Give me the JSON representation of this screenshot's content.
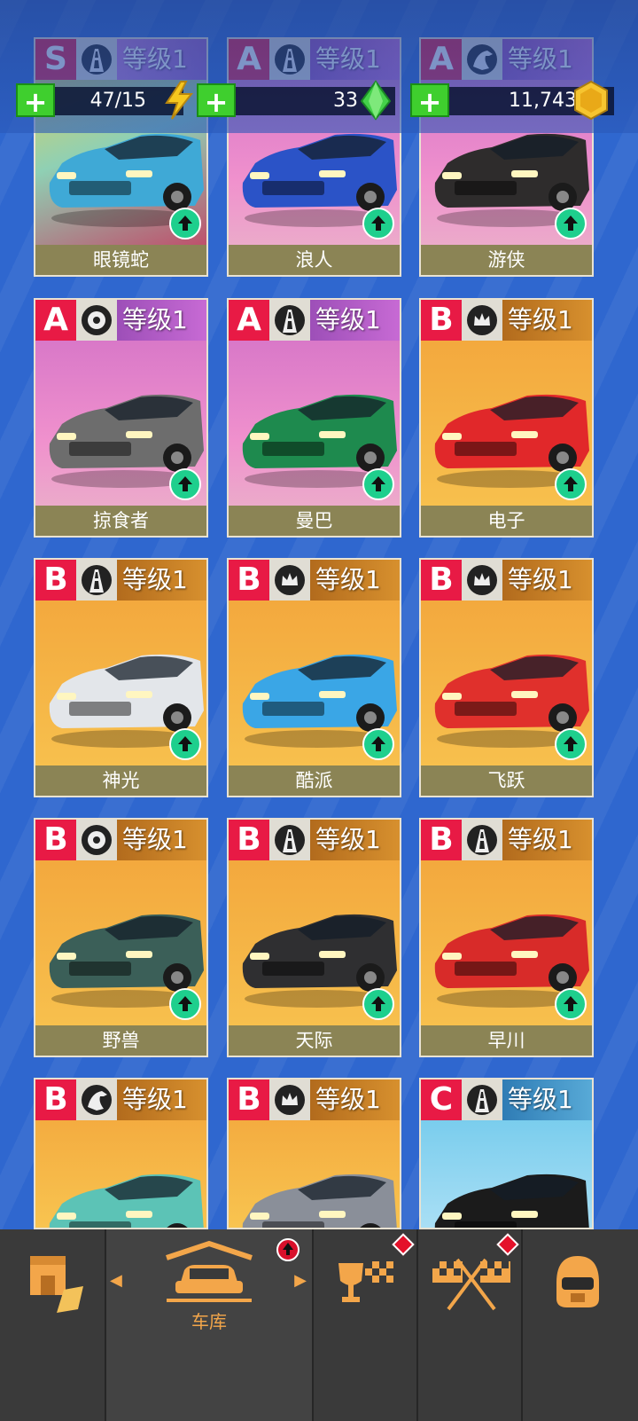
{
  "currency": {
    "energy": {
      "value": "47/15",
      "icon": "lightning-icon"
    },
    "gems": {
      "value": "33",
      "icon": "green-gem-icon"
    },
    "coins": {
      "value": "11,743",
      "icon": "gold-coin-icon"
    },
    "add_label": "+"
  },
  "cars": [
    {
      "tier": "S",
      "class_icon": "road-icon",
      "level": "等级1",
      "name": "眼镜蛇",
      "bg": "s",
      "body": "#3fa9d6"
    },
    {
      "tier": "A",
      "class_icon": "road-icon",
      "level": "等级1",
      "name": "浪人",
      "bg": "a",
      "body": "#2b53c7"
    },
    {
      "tier": "A",
      "class_icon": "horse-icon",
      "level": "等级1",
      "name": "游侠",
      "bg": "a",
      "body": "#2e2c2c"
    },
    {
      "tier": "A",
      "class_icon": "tire-icon",
      "level": "等级1",
      "name": "掠食者",
      "bg": "a",
      "body": "#6d6d6d"
    },
    {
      "tier": "A",
      "class_icon": "road-icon",
      "level": "等级1",
      "name": "曼巴",
      "bg": "a",
      "body": "#1e8a4e"
    },
    {
      "tier": "B",
      "class_icon": "crown-icon",
      "level": "等级1",
      "name": "电子",
      "bg": "b",
      "body": "#e1282a"
    },
    {
      "tier": "B",
      "class_icon": "road-icon",
      "level": "等级1",
      "name": "神光",
      "bg": "b",
      "body": "#e3e6ea"
    },
    {
      "tier": "B",
      "class_icon": "crown-icon",
      "level": "等级1",
      "name": "酷派",
      "bg": "b",
      "body": "#3aa6e6"
    },
    {
      "tier": "B",
      "class_icon": "crown-icon",
      "level": "等级1",
      "name": "飞跃",
      "bg": "b",
      "body": "#e0302c"
    },
    {
      "tier": "B",
      "class_icon": "tire-icon",
      "level": "等级1",
      "name": "野兽",
      "bg": "b",
      "body": "#3b5f58"
    },
    {
      "tier": "B",
      "class_icon": "road-icon",
      "level": "等级1",
      "name": "天际",
      "bg": "b",
      "body": "#2f2f31"
    },
    {
      "tier": "B",
      "class_icon": "road-icon",
      "level": "等级1",
      "name": "早川",
      "bg": "b",
      "body": "#d82b29"
    },
    {
      "tier": "B",
      "class_icon": "horse-icon",
      "level": "等级1",
      "name": "",
      "bg": "b",
      "body": "#5cc3b6"
    },
    {
      "tier": "B",
      "class_icon": "crown-icon",
      "level": "等级1",
      "name": "",
      "bg": "b",
      "body": "#8a8f99"
    },
    {
      "tier": "C",
      "class_icon": "road-icon",
      "level": "等级1",
      "name": "",
      "bg": "c",
      "body": "#1b1b1b"
    }
  ],
  "nav": {
    "shop": {
      "icon": "shop-icon"
    },
    "garage": {
      "label": "车库",
      "icon": "garage-car-icon",
      "badge": "upgrade-badge"
    },
    "trophies": {
      "icon": "trophy-flag-icon",
      "badge": "alert-badge"
    },
    "race": {
      "icon": "checkered-flags-icon",
      "badge": "alert-badge"
    },
    "profile": {
      "icon": "helmet-icon"
    }
  },
  "colors": {
    "accent": "#f3a64a",
    "tier": "#e81a45",
    "upgrade": "#1ecf8d",
    "name_bar": "#8b8455"
  }
}
